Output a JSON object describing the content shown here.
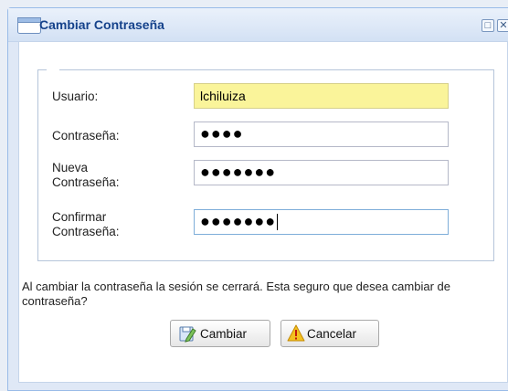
{
  "window": {
    "title": "Cambiar Contraseña",
    "maximize_glyph": "□",
    "close_glyph": "✕"
  },
  "form": {
    "usuario_label": "Usuario:",
    "usuario_value": "lchiluiza",
    "contrasena_label": "Contraseña:",
    "contrasena_value": "●●●●",
    "nueva_label_line1": "Nueva",
    "nueva_label_line2": "Contraseña:",
    "nueva_value": "●●●●●●●",
    "confirmar_label_line1": "Confirmar",
    "confirmar_label_line2": "Contraseña:",
    "confirmar_value": "●●●●●●●"
  },
  "message": "Al cambiar la contraseña la sesión se cerrará. Esta seguro que desea cambiar de contraseña?",
  "buttons": {
    "cambiar_label": "Cambiar",
    "cancelar_label": "Cancelar"
  },
  "icons": {
    "title": "window-icon",
    "cambiar": "save-pencil-icon",
    "cancelar": "warning-icon"
  }
}
